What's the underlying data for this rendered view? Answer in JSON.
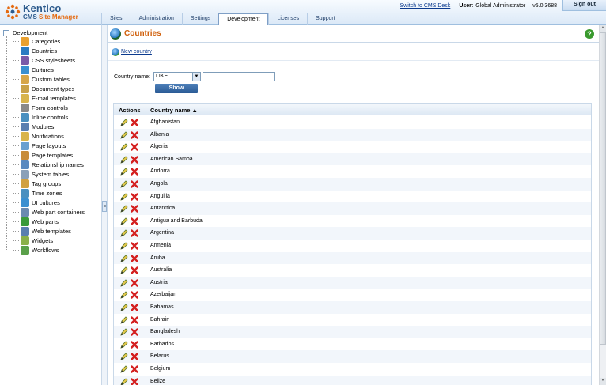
{
  "app": {
    "logo_name": "Kentico",
    "logo_product_a": "CMS ",
    "logo_product_b": "Site Manager",
    "brand_colors": {
      "blue": "#2d5b8d",
      "orange": "#e56a10"
    }
  },
  "header": {
    "tabs": [
      {
        "label": "Sites",
        "active": false
      },
      {
        "label": "Administration",
        "active": false
      },
      {
        "label": "Settings",
        "active": false
      },
      {
        "label": "Development",
        "active": true
      },
      {
        "label": "Licenses",
        "active": false
      },
      {
        "label": "Support",
        "active": false
      }
    ],
    "switch_link": "Switch to CMS Desk",
    "user_label": "User:",
    "user_name": "Global Administrator",
    "version": "v5.0.3688",
    "signout": "Sign out"
  },
  "tree": {
    "root": "Development",
    "items": [
      {
        "label": "Categories",
        "icon": "categories-icon",
        "color": "#e8a030"
      },
      {
        "label": "Countries",
        "icon": "globe-icon",
        "color": "#2a7bc2"
      },
      {
        "label": "CSS stylesheets",
        "icon": "css-icon",
        "color": "#7a5aa8"
      },
      {
        "label": "Cultures",
        "icon": "cultures-icon",
        "color": "#3a8fd0"
      },
      {
        "label": "Custom tables",
        "icon": "table-icon",
        "color": "#d6a64a"
      },
      {
        "label": "Document types",
        "icon": "document-type-icon",
        "color": "#c9a24a"
      },
      {
        "label": "E-mail templates",
        "icon": "email-icon",
        "color": "#d8b44c"
      },
      {
        "label": "Form controls",
        "icon": "form-control-icon",
        "color": "#8a8a8a"
      },
      {
        "label": "Inline controls",
        "icon": "inline-control-icon",
        "color": "#4a90c0"
      },
      {
        "label": "Modules",
        "icon": "module-icon",
        "color": "#5a7fb0"
      },
      {
        "label": "Notifications",
        "icon": "notification-icon",
        "color": "#d8b44c"
      },
      {
        "label": "Page layouts",
        "icon": "layout-icon",
        "color": "#6aa0d0"
      },
      {
        "label": "Page templates",
        "icon": "template-icon",
        "color": "#c88c3a"
      },
      {
        "label": "Relationship names",
        "icon": "relationship-icon",
        "color": "#5a8ac0"
      },
      {
        "label": "System tables",
        "icon": "system-table-icon",
        "color": "#8aa0b8"
      },
      {
        "label": "Tag groups",
        "icon": "tag-icon",
        "color": "#d0a040"
      },
      {
        "label": "Time zones",
        "icon": "clock-icon",
        "color": "#4a90c0"
      },
      {
        "label": "UI cultures",
        "icon": "ui-culture-icon",
        "color": "#3a8fd0"
      },
      {
        "label": "Web part containers",
        "icon": "container-icon",
        "color": "#6a8ab0"
      },
      {
        "label": "Web parts",
        "icon": "webpart-icon",
        "color": "#3a9a3a"
      },
      {
        "label": "Web templates",
        "icon": "web-template-icon",
        "color": "#5a7fb0"
      },
      {
        "label": "Widgets",
        "icon": "widget-icon",
        "color": "#8ab04a"
      },
      {
        "label": "Workflows",
        "icon": "workflow-icon",
        "color": "#5aa04a"
      }
    ]
  },
  "main": {
    "title": "Countries",
    "new_link": "New country",
    "help": "?",
    "filter": {
      "label": "Country name:",
      "operator": "LIKE",
      "value": "",
      "show_button": "Show"
    },
    "grid": {
      "col_actions": "Actions",
      "col_name": "Country name ▲",
      "rows": [
        "Afghanistan",
        "Albania",
        "Algeria",
        "American Samoa",
        "Andorra",
        "Angola",
        "Anguilla",
        "Antarctica",
        "Antigua and Barbuda",
        "Argentina",
        "Armenia",
        "Aruba",
        "Australia",
        "Austria",
        "Azerbaijan",
        "Bahamas",
        "Bahrain",
        "Bangladesh",
        "Barbados",
        "Belarus",
        "Belgium",
        "Belize"
      ]
    }
  }
}
